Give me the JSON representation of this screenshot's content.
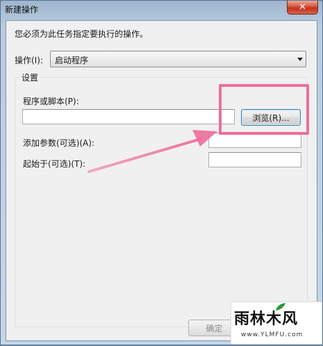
{
  "window": {
    "title": "新建操作",
    "close_label": "✕"
  },
  "dialog": {
    "instruction": "您必须为此任务指定要执行的操作。",
    "action_label": "操作(I):",
    "action_value": "启动程序",
    "settings_group_title": "设置",
    "program_label": "程序或脚本(P):",
    "program_value": "",
    "browse_label": "浏览(R)...",
    "args_label": "添加参数(可选)(A):",
    "args_value": "",
    "start_in_label": "起始于(可选)(T):",
    "start_in_value": "",
    "ok_label": "确定"
  },
  "annotation": {
    "highlight_color": "#ec6e9b"
  },
  "watermark": {
    "title": "雨林木风",
    "url": "www.YLMFU.com"
  }
}
